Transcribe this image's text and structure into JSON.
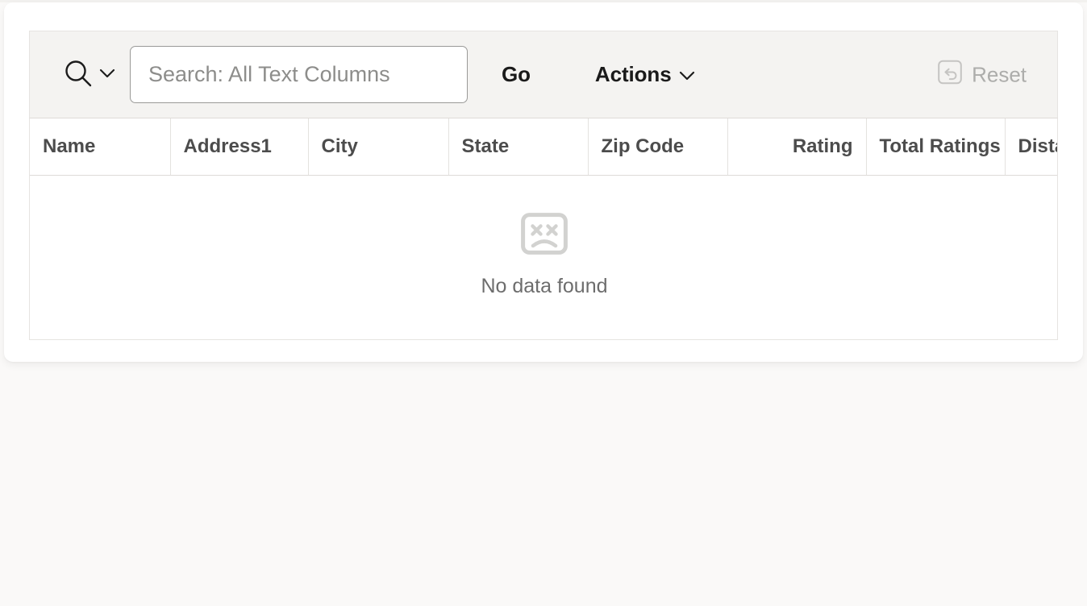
{
  "toolbar": {
    "search_icon": "search-icon",
    "search_dropdown_icon": "chevron-down-icon",
    "search_placeholder": "Search: All Text Columns",
    "search_value": "",
    "go_label": "Go",
    "actions_label": "Actions",
    "actions_dropdown_icon": "chevron-down-icon",
    "reset_label": "Reset",
    "reset_icon": "reset-undo-icon"
  },
  "table": {
    "columns": [
      {
        "label": "Name",
        "align": "left"
      },
      {
        "label": "Address1",
        "align": "left"
      },
      {
        "label": "City",
        "align": "left"
      },
      {
        "label": "State",
        "align": "left"
      },
      {
        "label": "Zip Code",
        "align": "left"
      },
      {
        "label": "Rating",
        "align": "right"
      },
      {
        "label": "Total Ratings",
        "align": "right"
      },
      {
        "label": "Distance",
        "align": "left"
      }
    ],
    "rows": [],
    "empty_icon": "sad-face-no-data-icon",
    "empty_message": "No data found"
  },
  "colors": {
    "page_background": "#faf9f8",
    "card_background": "#ffffff",
    "toolbar_background": "#f4f3f1",
    "border": "#e6e4e1",
    "header_text": "#4c4c4c",
    "muted_text": "#adadab",
    "empty_text": "#6d6d6d"
  }
}
